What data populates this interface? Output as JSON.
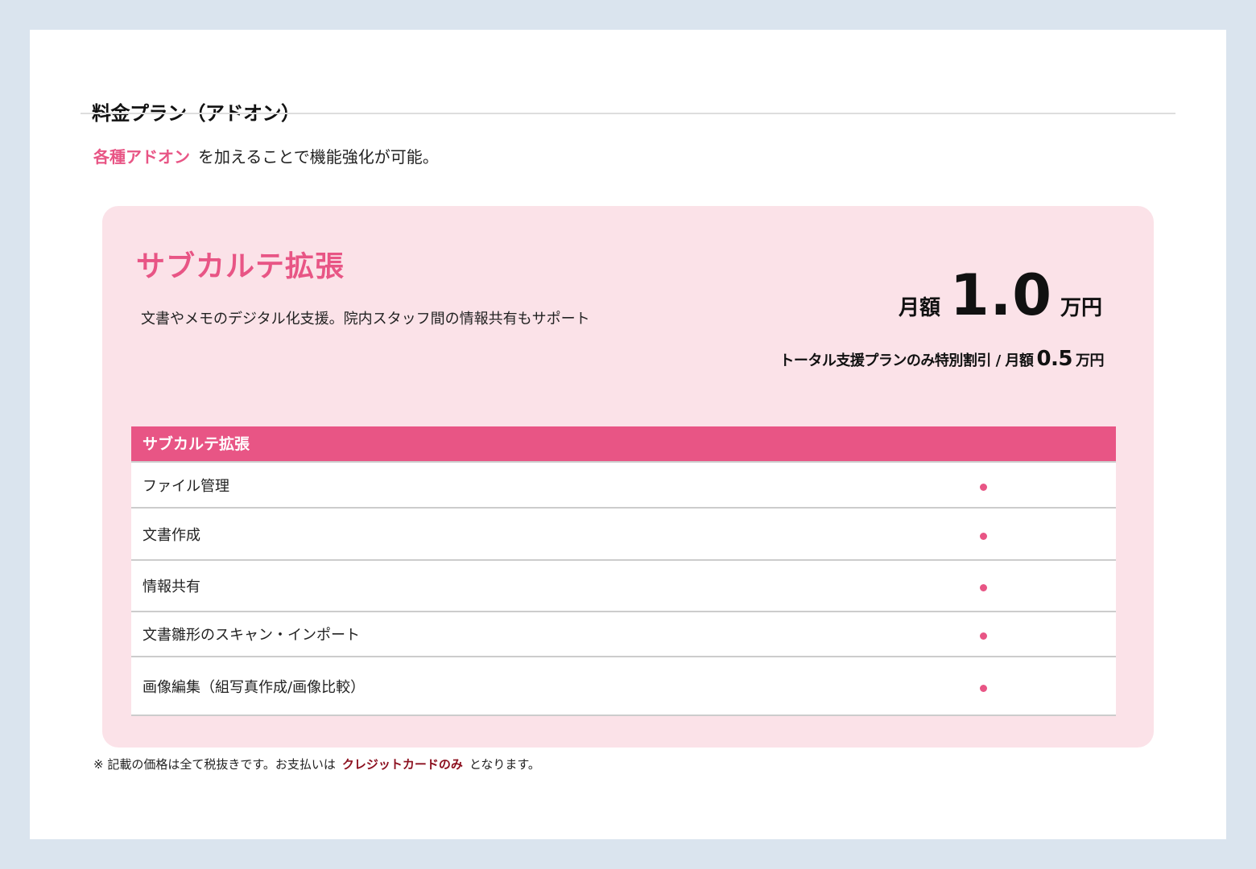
{
  "page": {
    "title": "料金プラン（アドオン）"
  },
  "intro": {
    "accent": "各種アドオン",
    "text": "を加えることで機能強化が可能。"
  },
  "card": {
    "title": "サブカルテ拡張",
    "description": "文書やメモのデジタル化支援。院内スタッフ間の情報共有もサポート",
    "price": {
      "label": "月額",
      "value": "1.0",
      "unit": "万円"
    },
    "discount": {
      "label": "トータル支援プランのみ特別割引 / 月額",
      "value": "0.5",
      "unit": "万円"
    },
    "table": {
      "header": "サブカルテ拡張",
      "rows": [
        {
          "name": "ファイル管理",
          "included": true
        },
        {
          "name": "文書作成",
          "included": true
        },
        {
          "name": "情報共有",
          "included": true
        },
        {
          "name": "文書雛形のスキャン・インポート",
          "included": true
        },
        {
          "name": "画像編集（組写真作成/画像比較）",
          "included": true
        }
      ]
    }
  },
  "footnote": {
    "prefix": "※ 記載の価格は全て税抜きです。お支払いは",
    "strong": "クレジットカードのみ",
    "suffix": "となります。"
  },
  "colors": {
    "accent": "#e85585",
    "card_background": "#fbe2e8",
    "page_background": "#dae4ee",
    "footnote_strong": "#8c0f1e"
  }
}
